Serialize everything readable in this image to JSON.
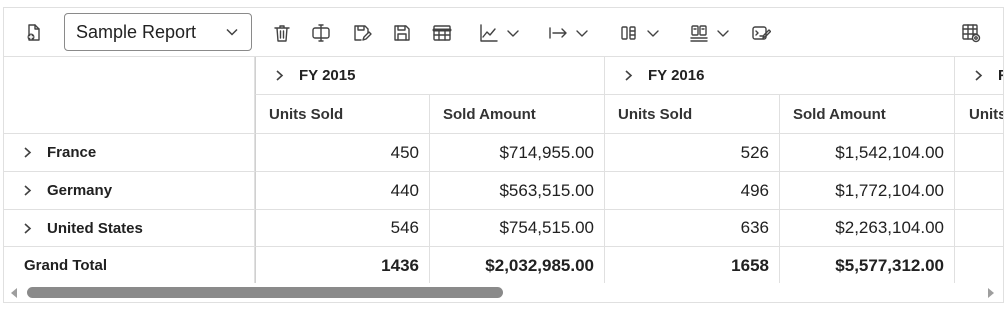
{
  "toolbar": {
    "report_name": "Sample Report",
    "icons": [
      "new-report-icon",
      "rename-icon",
      "delete-icon",
      "save-icon",
      "save-as-icon",
      "grid-icon",
      "chart-icon",
      "export-icon",
      "subtotal-icon",
      "grand-total-icon",
      "format-icon",
      "field-list-icon"
    ]
  },
  "pivot": {
    "column_groups": [
      "FY 2015",
      "FY 2016",
      "F"
    ],
    "measures": [
      "Units Sold",
      "Sold Amount",
      "Units Sold",
      "Sold Amount",
      "Units"
    ],
    "rows": [
      {
        "label": "France",
        "values": [
          "450",
          "$714,955.00",
          "526",
          "$1,542,104.00"
        ]
      },
      {
        "label": "Germany",
        "values": [
          "440",
          "$563,515.00",
          "496",
          "$1,772,104.00"
        ]
      },
      {
        "label": "United States",
        "values": [
          "546",
          "$754,515.00",
          "636",
          "$2,263,104.00"
        ]
      }
    ],
    "grand_total": {
      "label": "Grand Total",
      "values": [
        "1436",
        "$2,032,985.00",
        "1658",
        "$5,577,312.00"
      ]
    }
  }
}
